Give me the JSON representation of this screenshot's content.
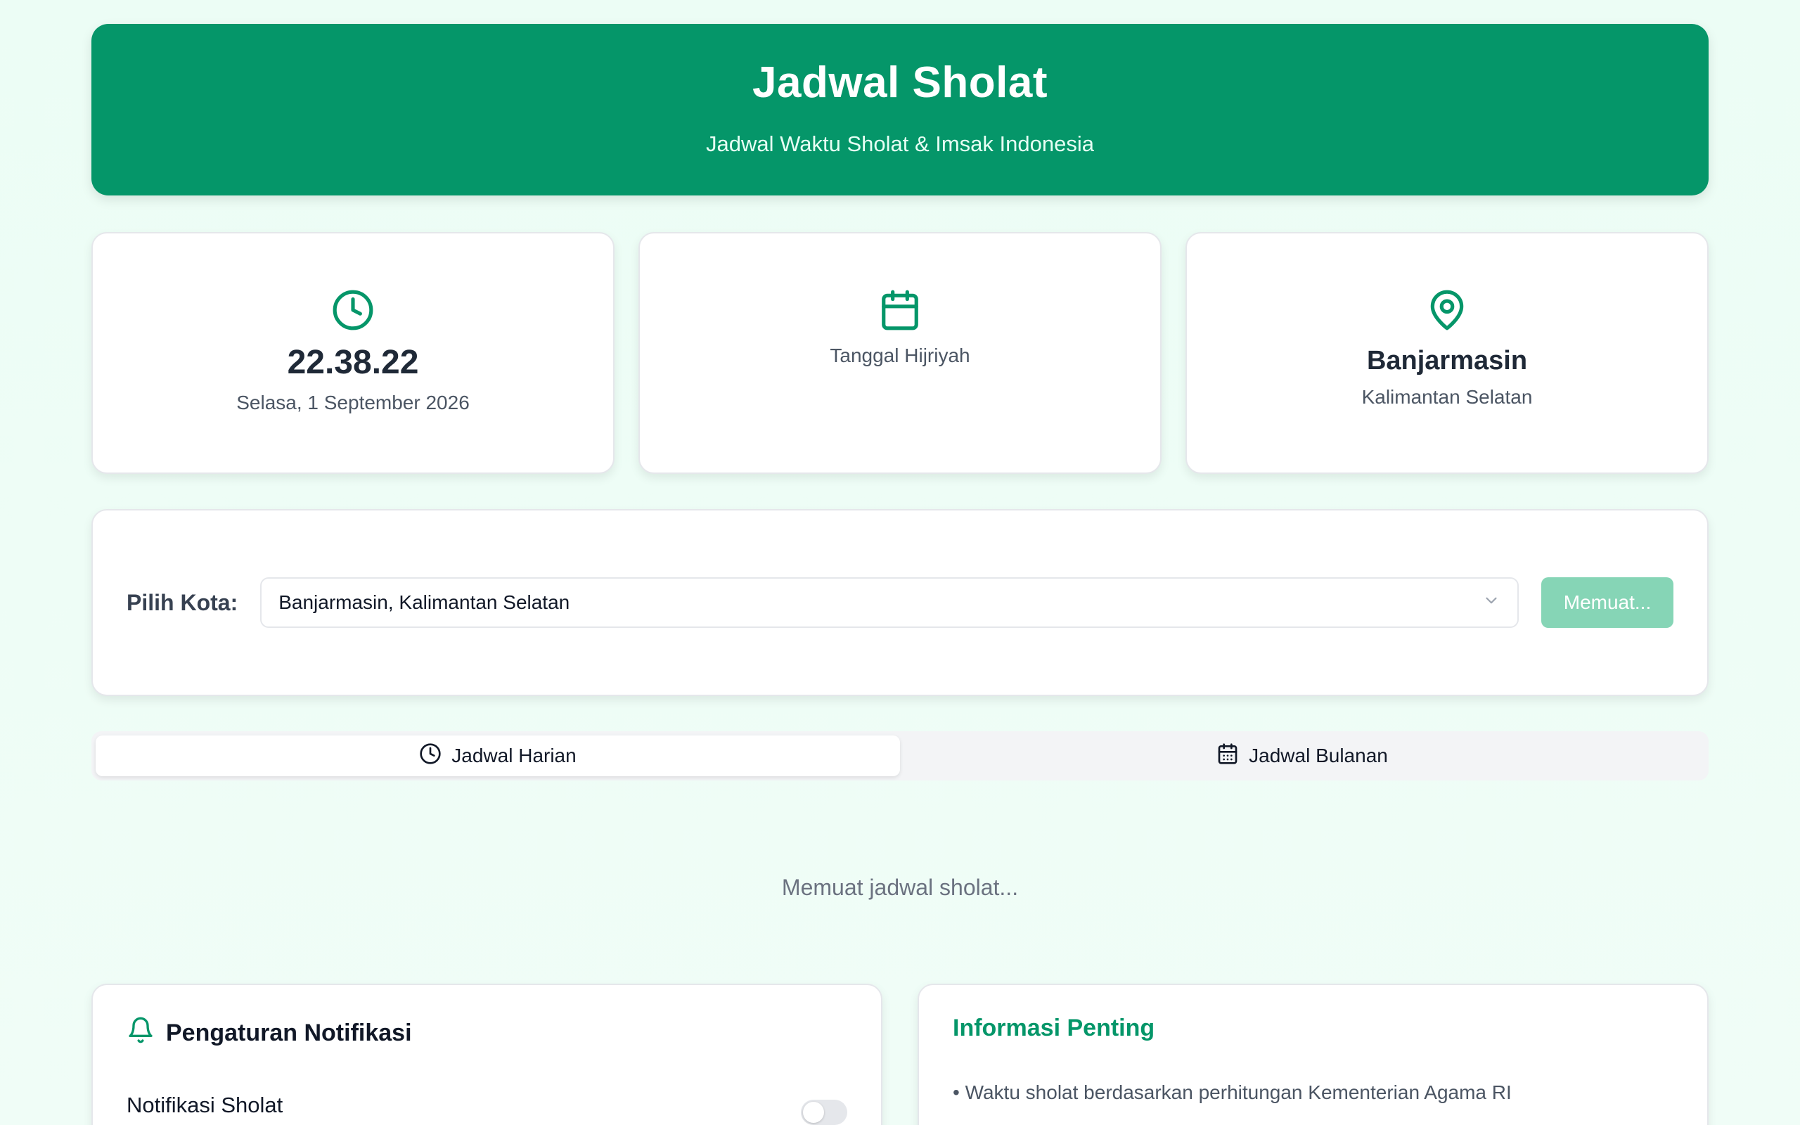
{
  "header": {
    "title": "Jadwal Sholat",
    "subtitle": "Jadwal Waktu Sholat & Imsak Indonesia"
  },
  "clock_card": {
    "icon": "clock-icon",
    "time": "22.38.22",
    "date": "Selasa, 1 September 2026"
  },
  "hijri_card": {
    "icon": "calendar-icon",
    "label": "Tanggal Hijriyah"
  },
  "location_card": {
    "icon": "map-pin-icon",
    "city": "Banjarmasin",
    "province": "Kalimantan Selatan"
  },
  "city_selector": {
    "label": "Pilih Kota:",
    "selected": "Banjarmasin, Kalimantan Selatan",
    "button_label": "Memuat..."
  },
  "tabs": [
    {
      "label": "Jadwal Harian",
      "icon": "clock-icon",
      "active": true
    },
    {
      "label": "Jadwal Bulanan",
      "icon": "calendar-icon",
      "active": false
    }
  ],
  "loading_text": "Memuat jadwal sholat...",
  "notifications": {
    "title": "Pengaturan Notifikasi",
    "icon": "bell-icon",
    "prayer_label": "Notifikasi Sholat",
    "enabled": false
  },
  "info": {
    "title": "Informasi Penting",
    "items": [
      "• Waktu sholat berdasarkan perhitungan Kementerian Agama RI"
    ]
  },
  "colors": {
    "primary": "#059669",
    "button_disabled": "#86d5b6",
    "background": "#ecfdf5"
  }
}
